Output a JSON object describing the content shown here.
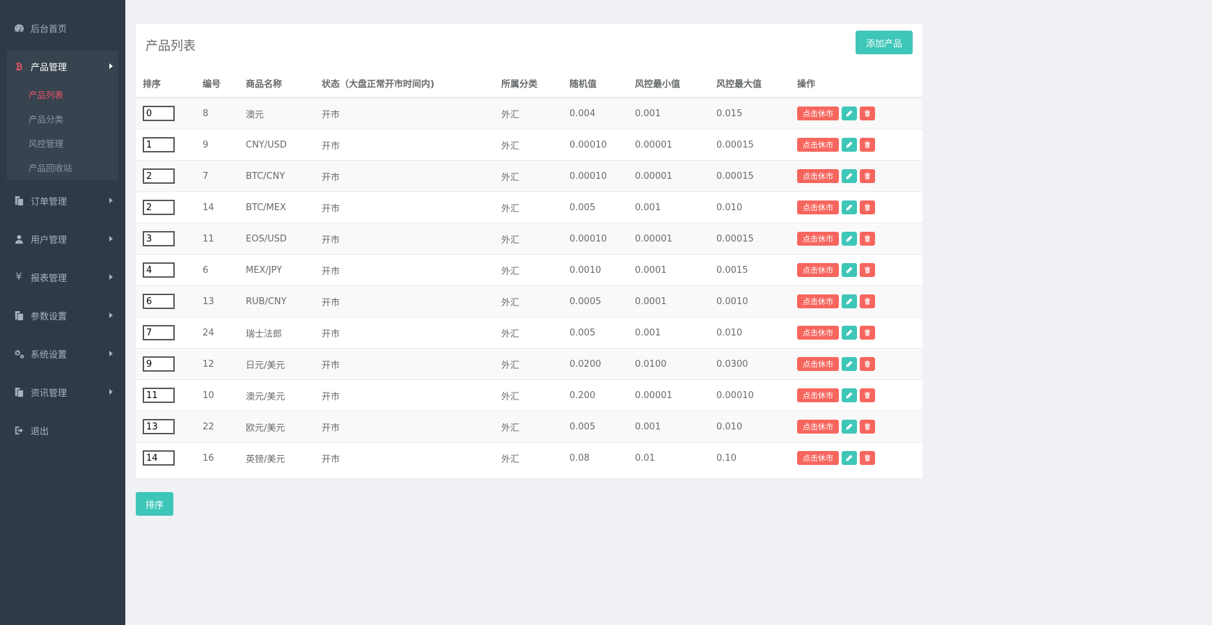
{
  "sidebar": {
    "items": [
      {
        "label": "后台首页",
        "icon": "dashboard-icon"
      },
      {
        "label": "产品管理",
        "icon": "bitcoin-icon"
      },
      {
        "label": "订单管理",
        "icon": "copy-icon"
      },
      {
        "label": "用户管理",
        "icon": "user-icon"
      },
      {
        "label": "报表管理",
        "icon": "yen-icon"
      },
      {
        "label": "参数设置",
        "icon": "copy-icon"
      },
      {
        "label": "系统设置",
        "icon": "cogs-icon"
      },
      {
        "label": "资讯管理",
        "icon": "copy-icon"
      },
      {
        "label": "退出",
        "icon": "sign-out-icon"
      }
    ],
    "sub_items": [
      "产品列表",
      "产品分类",
      "风控管理",
      "产品回收站"
    ]
  },
  "main": {
    "title": "产品列表",
    "add_button": "添加产品",
    "sort_button": "排序",
    "columns": [
      "排序",
      "编号",
      "商品名称",
      "状态（大盘正常开市时间内)",
      "所属分类",
      "随机值",
      "风控最小值",
      "风控最大值",
      "操作"
    ],
    "close_label": "点击休市",
    "rows": [
      {
        "sort": "0",
        "id": "8",
        "name": "澳元",
        "status": "开市",
        "category": "外汇",
        "random": "0.004",
        "min": "0.001",
        "max": "0.015"
      },
      {
        "sort": "1",
        "id": "9",
        "name": "CNY/USD",
        "status": "开市",
        "category": "外汇",
        "random": "0.00010",
        "min": "0.00001",
        "max": "0.00015"
      },
      {
        "sort": "2",
        "id": "7",
        "name": "BTC/CNY",
        "status": "开市",
        "category": "外汇",
        "random": "0.00010",
        "min": "0.00001",
        "max": "0.00015"
      },
      {
        "sort": "2",
        "id": "14",
        "name": "BTC/MEX",
        "status": "开市",
        "category": "外汇",
        "random": "0.005",
        "min": "0.001",
        "max": "0.010"
      },
      {
        "sort": "3",
        "id": "11",
        "name": "EOS/USD",
        "status": "开市",
        "category": "外汇",
        "random": "0.00010",
        "min": "0.00001",
        "max": "0.00015"
      },
      {
        "sort": "4",
        "id": "6",
        "name": "MEX/JPY",
        "status": "开市",
        "category": "外汇",
        "random": "0.0010",
        "min": "0.0001",
        "max": "0.0015"
      },
      {
        "sort": "6",
        "id": "13",
        "name": "RUB/CNY",
        "status": "开市",
        "category": "外汇",
        "random": "0.0005",
        "min": "0.0001",
        "max": "0.0010"
      },
      {
        "sort": "7",
        "id": "24",
        "name": "瑞士法郎",
        "status": "开市",
        "category": "外汇",
        "random": "0.005",
        "min": "0.001",
        "max": "0.010"
      },
      {
        "sort": "9",
        "id": "12",
        "name": "日元/美元",
        "status": "开市",
        "category": "外汇",
        "random": "0.0200",
        "min": "0.0100",
        "max": "0.0300"
      },
      {
        "sort": "11",
        "id": "10",
        "name": "澳元/美元",
        "status": "开市",
        "category": "外汇",
        "random": "0.200",
        "min": "0.00001",
        "max": "0.00010"
      },
      {
        "sort": "13",
        "id": "22",
        "name": "欧元/美元",
        "status": "开市",
        "category": "外汇",
        "random": "0.005",
        "min": "0.001",
        "max": "0.010"
      },
      {
        "sort": "14",
        "id": "16",
        "name": "英镑/美元",
        "status": "开市",
        "category": "外汇",
        "random": "0.08",
        "min": "0.01",
        "max": "0.10"
      }
    ]
  },
  "colors": {
    "sidebar_bg": "#2f3a47",
    "accent_teal": "#3ec6b8",
    "danger_red": "#f7665e",
    "active_sub": "#ed5565",
    "page_bg": "#f0f1f5"
  }
}
